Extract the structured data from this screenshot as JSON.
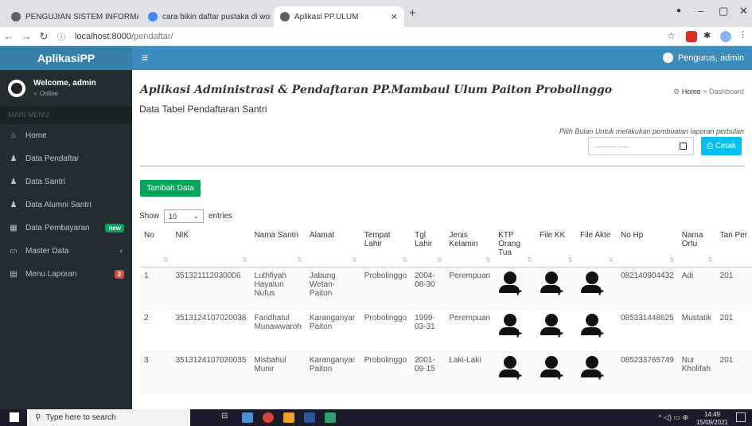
{
  "browser": {
    "tabs": [
      {
        "title": "PENGUJIAN SISTEM INFORMASI"
      },
      {
        "title": "cara bikin daftar pustaka di word"
      },
      {
        "title": "Aplikasi PP.ULUM"
      }
    ],
    "url_host": "localhost:8000",
    "url_path": "/pendaftar/"
  },
  "sidebar": {
    "logo": "AplikasiPP",
    "welcome": "Welcome, admin",
    "status": "Online",
    "menu_header": "MAIN MENU",
    "items": [
      {
        "label": "Home",
        "icon": "home-icon"
      },
      {
        "label": "Data Pendaftar",
        "icon": "user-icon"
      },
      {
        "label": "Data Santri",
        "icon": "user-icon"
      },
      {
        "label": "Data Alumni Santri",
        "icon": "user-icon"
      },
      {
        "label": "Data Pembayaran",
        "icon": "table-icon",
        "badge": "new"
      },
      {
        "label": "Master Data",
        "icon": "laptop-icon"
      },
      {
        "label": "Menu Laporan",
        "icon": "calendar-icon",
        "badge": "3"
      }
    ]
  },
  "topbar": {
    "account": "Pengurus, admin"
  },
  "content": {
    "title": "Aplikasi Administrasi & Pendaftaran PP.Mambaul Ulum Paiton Probolinggo",
    "breadcrumb_home": "Home",
    "breadcrumb_current": "Dashboard",
    "subtitle": "Data Tabel Pendaftaran Santri",
    "hint": "Pilih Bulan Untuk melakukan pembuatan laporan perbulan",
    "date_placeholder": "--------- ----",
    "print_label": "Cetak",
    "add_label": "Tambah Data",
    "show_label": "Show",
    "entries_value": "10",
    "entries_label": "entries"
  },
  "table": {
    "headers": [
      "No",
      "NIK",
      "Nama Santri",
      "Alamat",
      "Tempat Lahir",
      "Tgl Lahir",
      "Jenis Kelamin",
      "KTP Orang Tua",
      "File KK",
      "File Akte",
      "No Hp",
      "Nama Ortu",
      "Tan Per"
    ],
    "rows": [
      {
        "no": "1",
        "nik": "351321112030006",
        "nama": "Luthfiyah Hayatun Nufus",
        "alamat": "Jabung Wetan- Paiton",
        "tempat": "Probolinggo",
        "tgl": "2004- 08-30",
        "jk": "Perempuan",
        "hp": "082140904432",
        "ortu": "Adi",
        "tan": "201"
      },
      {
        "no": "2",
        "nik": "3513124107020038",
        "nama": "Faridhatul Munawwaroh",
        "alamat": "Karanganyar Paiton",
        "tempat": "Probolinggo",
        "tgl": "1999- 03-31",
        "jk": "Perempuan",
        "hp": "085331448625",
        "ortu": "Mustatik",
        "tan": "201"
      },
      {
        "no": "3",
        "nik": "3513124107020035",
        "nama": "Misbahul Munir",
        "alamat": "Karanganyar Paiton",
        "tempat": "Probolinggo",
        "tgl": "2001- 09-15",
        "jk": "Laki-Laki",
        "hp": "085233765749",
        "ortu": "Nur Kholifah",
        "tan": "201"
      }
    ]
  },
  "taskbar": {
    "search_placeholder": "Type here to search",
    "time": "14:49",
    "date": "15/09/2021"
  },
  "colors": {
    "sidebar": "#222d32",
    "topbar": "#3c8dbc",
    "logo": "#367fa9",
    "green": "#00a65a",
    "cyan": "#00c0ef"
  }
}
